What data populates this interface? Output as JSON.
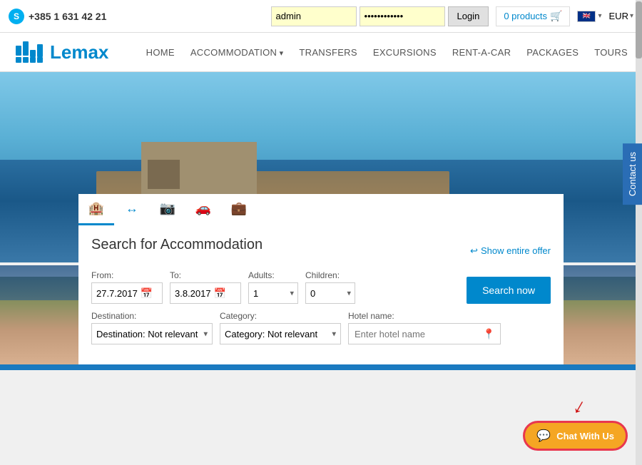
{
  "topbar": {
    "phone": "+385 1 631 42 21",
    "username_value": "admin",
    "password_placeholder": "············",
    "login_label": "Login",
    "cart_label": "0 products",
    "currency": "EUR"
  },
  "nav": {
    "home": "HOME",
    "accommodation": "ACCOMMODATION",
    "transfers": "TRANSFERS",
    "excursions": "EXCURSIONS",
    "rent_a_car": "RENT-A-CAR",
    "packages": "PACKAGES",
    "tours": "TOURS"
  },
  "contact_tab": "Contact us",
  "search": {
    "title": "Search for Accommodation",
    "show_offer_label": "Show entire offer",
    "from_label": "From:",
    "from_value": "27.7.2017",
    "to_label": "To:",
    "to_value": "3.8.2017",
    "adults_label": "Adults:",
    "adults_value": "1",
    "children_label": "Children:",
    "children_value": "0",
    "search_now_label": "Search now",
    "destination_label": "Destination:",
    "destination_value": "Destination: Not relevant",
    "category_label": "Category:",
    "category_value": "Category: Not relevant",
    "hotel_name_label": "Hotel name:",
    "hotel_name_placeholder": "Enter hotel name"
  },
  "chat": {
    "label": "Chat With Us"
  },
  "tabs": [
    {
      "icon": "🏨",
      "label": "accommodation"
    },
    {
      "icon": "↔",
      "label": "transfers"
    },
    {
      "icon": "📷",
      "label": "excursions"
    },
    {
      "icon": "🚗",
      "label": "rent-a-car"
    },
    {
      "icon": "💼",
      "label": "packages"
    }
  ]
}
